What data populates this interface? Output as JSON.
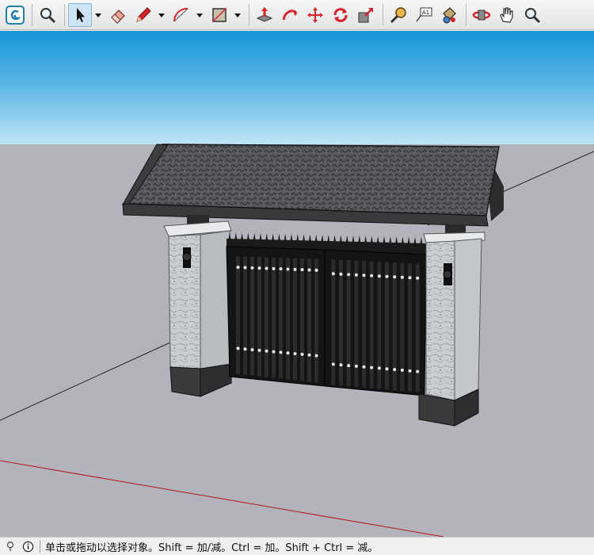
{
  "toolbar": {
    "tools": [
      {
        "name": "sketchup-logo-icon"
      },
      {
        "name": "zoom-icon"
      },
      {
        "name": "select-arrow-icon"
      },
      {
        "name": "eraser-icon"
      },
      {
        "name": "pencil-line-icon"
      },
      {
        "name": "arc-icon"
      },
      {
        "name": "rectangle-icon"
      },
      {
        "name": "push-pull-icon"
      },
      {
        "name": "follow-me-icon"
      },
      {
        "name": "move-icon"
      },
      {
        "name": "rotate-icon"
      },
      {
        "name": "scale-icon"
      },
      {
        "name": "tape-measure-icon"
      },
      {
        "name": "text-label-icon"
      },
      {
        "name": "paint-bucket-icon"
      },
      {
        "name": "orbit-icon"
      },
      {
        "name": "pan-hand-icon"
      },
      {
        "name": "zoom-window-icon"
      }
    ],
    "colors": {
      "accent": "#1f7fb0",
      "red": "#d8232a",
      "active_bg": "#cfe3f7"
    }
  },
  "viewport": {
    "sky_top": "#1596d8",
    "sky_bottom": "#bfe5f6",
    "ground": "#b4b3bb"
  },
  "statusbar": {
    "text": "单击或拖动以选择对象。Shift = 加/减。Ctrl = 加。Shift + Ctrl = 减。"
  }
}
